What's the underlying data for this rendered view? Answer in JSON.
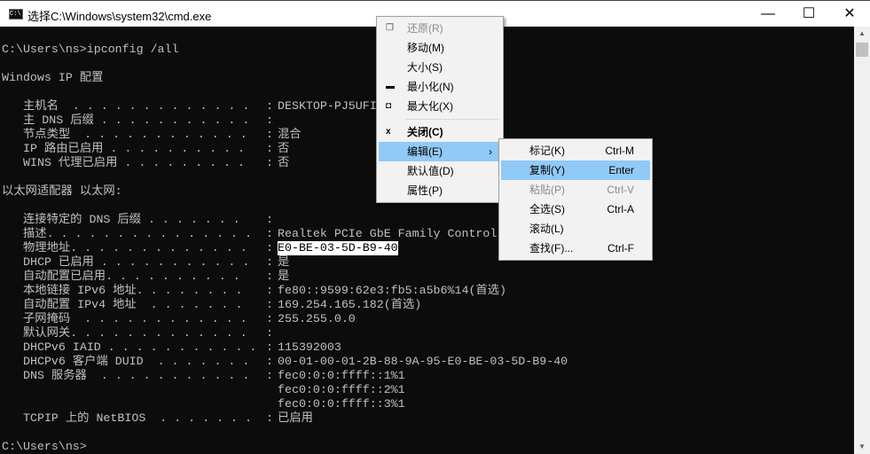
{
  "window": {
    "title": "选择C:\\Windows\\system32\\cmd.exe",
    "minimize": "—",
    "maximize": "☐",
    "close": "✕"
  },
  "terminal": {
    "command_line": "C:\\Users\\ns>ipconfig /all",
    "ip_config_header": "Windows IP 配置",
    "ip_config": [
      {
        "label": "主机名  . . . . . . . . . . . . .",
        "value": "DESKTOP-PJ5UFI"
      },
      {
        "label": "主 DNS 后缀 . . . . . . . . . . .",
        "value": ""
      },
      {
        "label": "节点类型  . . . . . . . . . . . .",
        "value": "混合"
      },
      {
        "label": "IP 路由已启用 . . . . . . . . . .",
        "value": "否"
      },
      {
        "label": "WINS 代理已启用 . . . . . . . . .",
        "value": "否"
      }
    ],
    "adapter_header": "以太网适配器 以太网:",
    "adapter": [
      {
        "label": "连接特定的 DNS 后缀 . . . . . . .",
        "value": ""
      },
      {
        "label": "描述. . . . . . . . . . . . . . .",
        "value": "Realtek PCIe GbE Family Control"
      },
      {
        "label": "物理地址. . . . . . . . . . . . .",
        "value": "E0-BE-03-5D-B9-40",
        "selected": true
      },
      {
        "label": "DHCP 已启用 . . . . . . . . . . .",
        "value": "是"
      },
      {
        "label": "自动配置已启用. . . . . . . . . .",
        "value": "是"
      },
      {
        "label": "本地链接 IPv6 地址. . . . . . . .",
        "value": "fe80::9599:62e3:fb5:a5b6%14(首选)"
      },
      {
        "label": "自动配置 IPv4 地址  . . . . . . .",
        "value": "169.254.165.182(首选)"
      },
      {
        "label": "子网掩码  . . . . . . . . . . . .",
        "value": "255.255.0.0"
      },
      {
        "label": "默认网关. . . . . . . . . . . . .",
        "value": ""
      },
      {
        "label": "DHCPv6 IAID . . . . . . . . . . .",
        "value": "115392003"
      },
      {
        "label": "DHCPv6 客户端 DUID  . . . . . . .",
        "value": "00-01-00-01-2B-88-9A-95-E0-BE-03-5D-B9-40"
      },
      {
        "label": "DNS 服务器  . . . . . . . . . . .",
        "value": "fec0:0:0:ffff::1%1"
      },
      {
        "label": "",
        "value": "fec0:0:0:ffff::2%1",
        "nocolon": true
      },
      {
        "label": "",
        "value": "fec0:0:0:ffff::3%1",
        "nocolon": true
      },
      {
        "label": "TCPIP 上的 NetBIOS  . . . . . . .",
        "value": "已启用"
      }
    ],
    "prompt": "C:\\Users\\ns>"
  },
  "system_menu": [
    {
      "label": "还原(R)",
      "icon": "restore-icon",
      "glyph": "❐",
      "disabled": true
    },
    {
      "label": "移动(M)"
    },
    {
      "label": "大小(S)"
    },
    {
      "label": "最小化(N)",
      "icon": "minimize-icon",
      "glyph": "▬"
    },
    {
      "label": "最大化(X)",
      "icon": "maximize-icon",
      "glyph": "◘"
    },
    {
      "label": "关闭(C)",
      "icon": "close-icon",
      "glyph": "x",
      "bold": true,
      "separator_before": true
    },
    {
      "label": "编辑(E)",
      "submenu": true,
      "highlighted": true
    },
    {
      "label": "默认值(D)"
    },
    {
      "label": "属性(P)"
    }
  ],
  "edit_submenu": [
    {
      "label": "标记(K)",
      "shortcut": "Ctrl-M"
    },
    {
      "label": "复制(Y)",
      "shortcut": "Enter",
      "highlighted": true
    },
    {
      "label": "粘贴(P)",
      "shortcut": "Ctrl-V",
      "disabled": true
    },
    {
      "label": "全选(S)",
      "shortcut": "Ctrl-A"
    },
    {
      "label": "滚动(L)",
      "shortcut": ""
    },
    {
      "label": "查找(F)...",
      "shortcut": "Ctrl-F"
    }
  ]
}
